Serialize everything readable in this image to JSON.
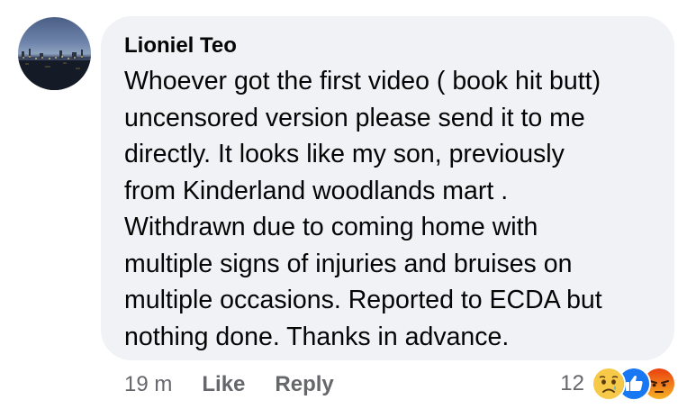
{
  "comment": {
    "author": "Lioniel Teo",
    "text_lines": [
      "Whoever got the first video ( book hit butt)",
      "uncensored version please send it to me",
      "directly. It looks like my son, previously",
      "from Kinderland woodlands mart .",
      "Withdrawn due to coming home with",
      "multiple signs of injuries and bruises on",
      "multiple occasions. Reported to ECDA but",
      "nothing done. Thanks in advance."
    ],
    "time": "19 m",
    "like_label": "Like",
    "reply_label": "Reply",
    "reaction_count": "12",
    "reactions": [
      "sad-icon",
      "like-icon",
      "angry-icon"
    ]
  },
  "colors": {
    "bubble": "#f0f2f5",
    "text": "#050505",
    "meta": "#65676b",
    "like_blue": "#1877f2",
    "sad_yellow": "#f7c948",
    "angry_orange": "#e9710f"
  }
}
